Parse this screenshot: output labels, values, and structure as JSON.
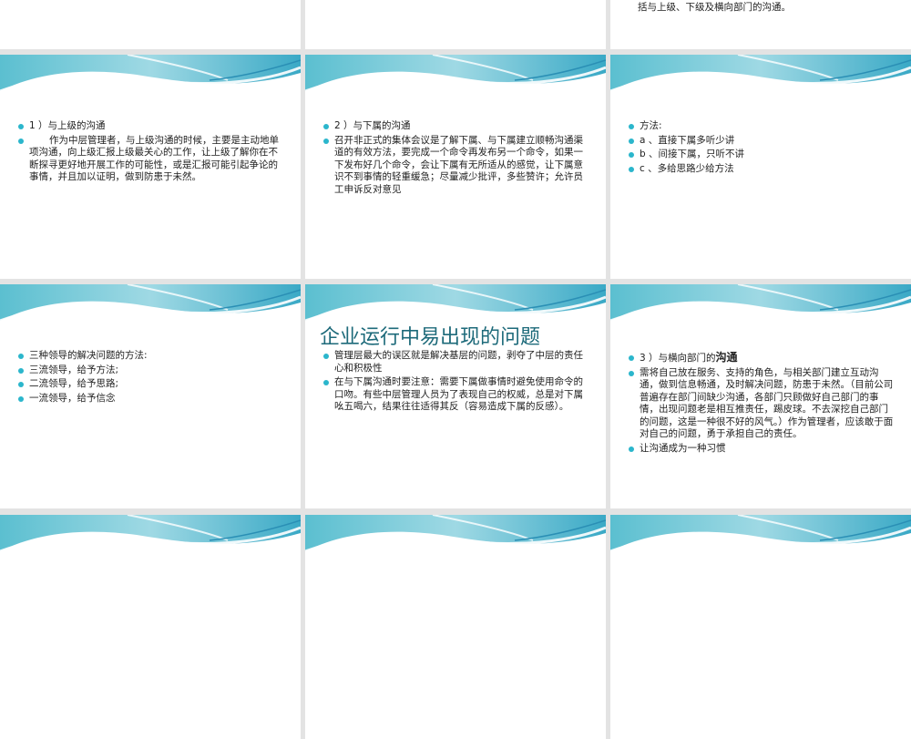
{
  "slides": [
    {
      "partial_text": ""
    },
    {
      "partial_text": ""
    },
    {
      "partial_text": "括与上级、下级及横向部门的沟通。"
    },
    {
      "bullets": [
        "1 ）与上级的沟通",
        "作为中层管理者，与上级沟通的时候，主要是主动地单项沟通，向上级汇报上级最关心的工作，让上级了解你在不断探寻更好地开展工作的可能性，或是汇报可能引起争论的事情，并且加以证明，做到防患于未然。"
      ]
    },
    {
      "bullets": [
        "2 ）与下属的沟通",
        "召开非正式的集体会议是了解下属、与下属建立顺畅沟通渠道的有效方法，要完成一个命令再发布另一个命令，如果一下发布好几个命令，会让下属有无所适从的感觉，让下属意识不到事情的轻重缓急；尽量减少批评，多些赞许；允许员工申诉反对意见"
      ]
    },
    {
      "bullets": [
        "方法:",
        "a 、直接下属多听少讲",
        "b 、间接下属，只听不讲",
        "c 、多给思路少给方法"
      ]
    },
    {
      "bullets": [
        "三种领导的解决问题的方法:",
        "三流领导，给予方法;",
        "二流领导，给予思路;",
        "一流领导，给予信念"
      ]
    },
    {
      "title": "企业运行中易出现的问题",
      "bullets": [
        "管理层最大的误区就是解决基层的问题，剥夺了中层的责任心和积极性",
        "在与下属沟通时要注意：需要下属做事情时避免使用命令的口吻。有些中层管理人员为了表现自己的权威，总是对下属吆五喝六，结果往往适得其反（容易造成下属的反感）。"
      ]
    },
    {
      "bullet1_prefix": "3 ）与横向部门的",
      "bullet1_bold": "沟通",
      "bullets": [
        "需将自己放在服务、支持的角色，与相关部门建立互动沟通，做到信息畅通，及时解决问题，防患于未然。（目前公司普遍存在部门间缺少沟通，各部门只顾做好自己部门的事情，出现问题老是相互推责任，踢皮球。不去深挖自己部门的问题，这是一种很不好的风气。）作为管理者，应该敢于面对自己的问题，勇于承担自己的责任。",
        "让沟通成为一种习惯"
      ]
    }
  ],
  "colors": {
    "accent": "#2bb6cc",
    "title": "#1d6a7a"
  }
}
